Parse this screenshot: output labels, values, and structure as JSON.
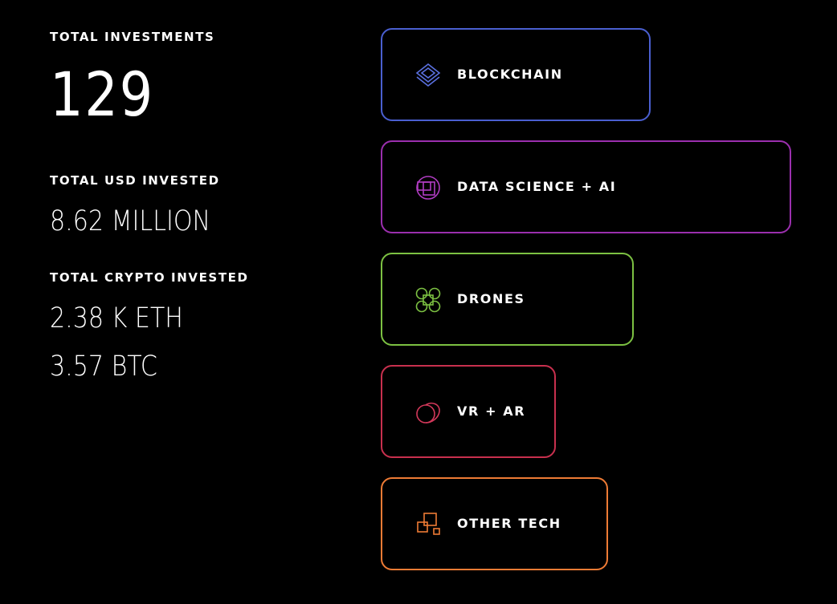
{
  "stats": {
    "total_investments_label": "TOTAL INVESTMENTS",
    "total_investments_value": "129",
    "total_usd_label": "TOTAL USD INVESTED",
    "total_usd_value": "8.62 MILLION",
    "total_crypto_label": "TOTAL CRYPTO INVESTED",
    "total_crypto_eth": "2.38 K ETH",
    "total_crypto_btc": "3.57 BTC"
  },
  "sectors": [
    {
      "label": "BLOCKCHAIN",
      "icon": "blockchain-layers-icon",
      "color": "#4a5fd0"
    },
    {
      "label": "DATA SCIENCE + AI",
      "icon": "data-science-icon",
      "color": "#9b2fae"
    },
    {
      "label": "DRONES",
      "icon": "drone-icon",
      "color": "#7cc142"
    },
    {
      "label": "VR + AR",
      "icon": "vr-ar-icon",
      "color": "#c8304e"
    },
    {
      "label": "OTHER TECH",
      "icon": "other-tech-icon",
      "color": "#ee7b35"
    }
  ]
}
